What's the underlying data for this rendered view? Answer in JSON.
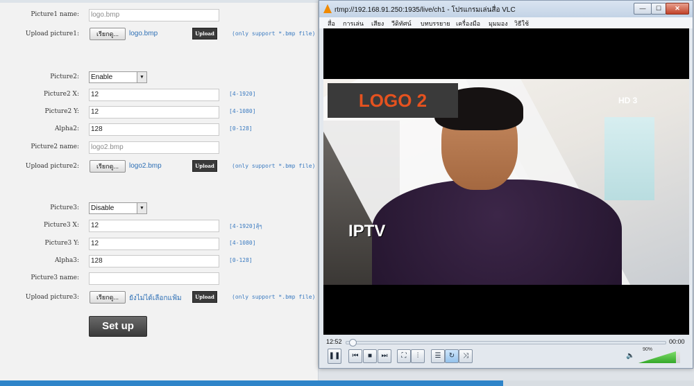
{
  "form": {
    "picture1": {
      "name_label": "Picture1 name:",
      "name_value": "logo.bmp",
      "upload_label": "Upload picture1:",
      "browse_label": "เรียกดู...",
      "file_value": "logo.bmp",
      "upload_button": "Upload",
      "upload_hint": "(only support *.bmp file)"
    },
    "picture2": {
      "enable_label": "Picture2:",
      "enable_value": "Enable",
      "x_label": "Picture2 X:",
      "x_value": "12",
      "x_hint": "[4-1920]",
      "y_label": "Picture2 Y:",
      "y_value": "12",
      "y_hint": "[4-1080]",
      "alpha_label": "Alpha2:",
      "alpha_value": "128",
      "alpha_hint": "[0-128]",
      "name_label": "Picture2 name:",
      "name_value": "logo2.bmp",
      "upload_label": "Upload picture2:",
      "browse_label": "เรียกดู...",
      "file_value": "logo2.bmp",
      "upload_button": "Upload",
      "upload_hint": "(only support *.bmp file)"
    },
    "picture3": {
      "enable_label": "Picture3:",
      "enable_value": "Disable",
      "x_label": "Picture3 X:",
      "x_value": "12",
      "x_hint": "[4-1920]สุ้ๆ",
      "y_label": "Picture3 Y:",
      "y_value": "12",
      "y_hint": "[4-1080]",
      "alpha_label": "Alpha3:",
      "alpha_value": "128",
      "alpha_hint": "[0-128]",
      "name_label": "Picture3 name:",
      "name_value": "",
      "upload_label": "Upload picture3:",
      "browse_label": "เรียกดู...",
      "file_value": "ยังไม่ได้เลือกแฟ้ม",
      "upload_button": "Upload",
      "upload_hint": "(only support *.bmp file)"
    },
    "setup_button": "Set up"
  },
  "vlc": {
    "title": "rtmp://192.168.91.250:1935/live/ch1 - โปรแกรมเล่นสื่อ VLC",
    "window_buttons": {
      "minimize": "—",
      "maximize": "☐",
      "close": "✕"
    },
    "menu": [
      "สื่อ",
      "การเล่น",
      "เสียง",
      "วีดิทัศน์",
      "บทบรรยาย",
      "เครื่องมือ",
      "มุมมอง",
      "วิธีใช้"
    ],
    "overlays": {
      "logo": "LOGO 2",
      "iptv": "IPTV",
      "channel": "HD 3"
    },
    "time_elapsed": "12:52",
    "time_total": "00:00",
    "seek_fraction": 0.02,
    "volume_percent": "90%",
    "volume_fraction": 0.9,
    "controls": [
      {
        "name": "pause-button",
        "icon": "❚❚"
      },
      {
        "name": "prev-button",
        "icon": "⏮"
      },
      {
        "name": "stop-button",
        "icon": "■"
      },
      {
        "name": "next-button",
        "icon": "⏭"
      },
      {
        "name": "fullscreen-button",
        "icon": "⛶"
      },
      {
        "name": "extended-settings-button",
        "icon": "⫶"
      },
      {
        "name": "playlist-button",
        "icon": "☰"
      },
      {
        "name": "loop-button",
        "icon": "↻"
      },
      {
        "name": "shuffle-button",
        "icon": "⤨"
      }
    ],
    "colors": {
      "accent_orange": "#f08a00",
      "volume_green": "#34a82a",
      "logo_text": "#e5521f"
    }
  }
}
